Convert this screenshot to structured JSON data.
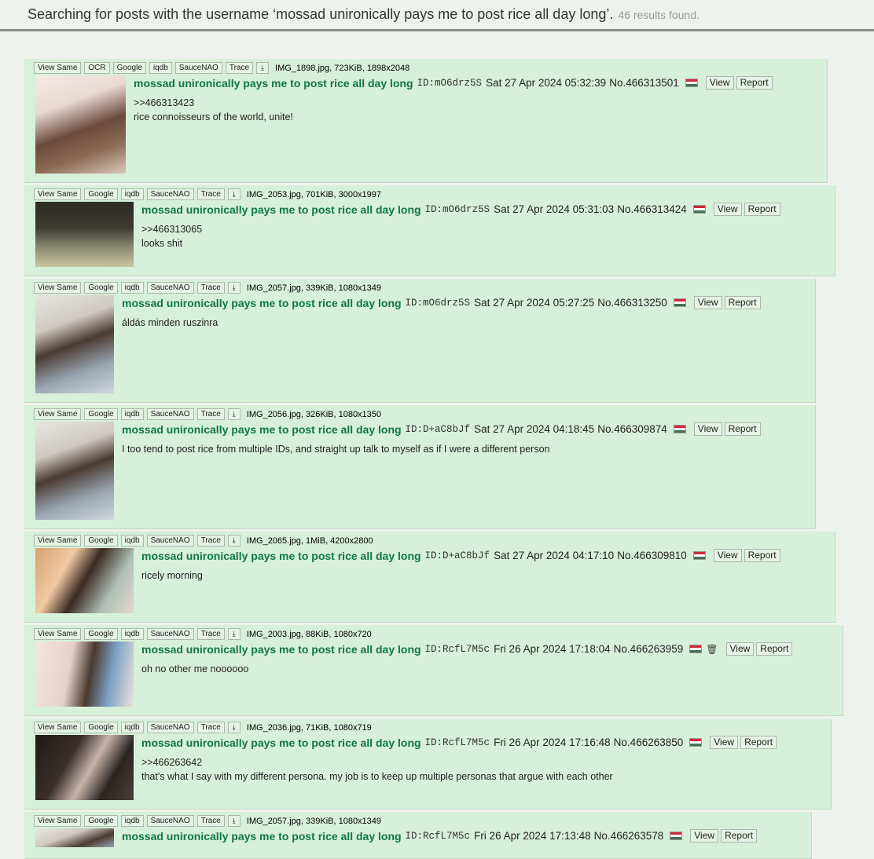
{
  "header": {
    "text": "Searching for posts with the username ‘mossad unironically pays me to post rice all day long’.",
    "count": "46 results found."
  },
  "buttons": {
    "view_same": "View Same",
    "ocr": "OCR",
    "google": "Google",
    "iqdb": "iqdb",
    "saucenao": "SauceNAO",
    "trace": "Trace",
    "view": "View",
    "report": "Report"
  },
  "posts": [
    {
      "file": "IMG_1898.jpg, 723KiB, 1898x2048",
      "name": "mossad unironically pays me to post rice all day long",
      "uid": "ID:mO6drz5S",
      "datetime": "Sat 27 Apr 2024 05:32:39",
      "no": "No.466313501",
      "quote": ">>466313423",
      "text": "rice connoisseurs of the world, unite!"
    },
    {
      "file": "IMG_2053.jpg, 701KiB, 3000x1997",
      "name": "mossad unironically pays me to post rice all day long",
      "uid": "ID:mO6drz5S",
      "datetime": "Sat 27 Apr 2024 05:31:03",
      "no": "No.466313424",
      "quote": ">>466313065",
      "text": "looks shit"
    },
    {
      "file": "IMG_2057.jpg, 339KiB, 1080x1349",
      "name": "mossad unironically pays me to post rice all day long",
      "uid": "ID:mO6drz5S",
      "datetime": "Sat 27 Apr 2024 05:27:25",
      "no": "No.466313250",
      "quote": "",
      "text": "áldás minden ruszinra"
    },
    {
      "file": "IMG_2056.jpg, 326KiB, 1080x1350",
      "name": "mossad unironically pays me to post rice all day long",
      "uid": "ID:D+aC8bJf",
      "datetime": "Sat 27 Apr 2024 04:18:45",
      "no": "No.466309874",
      "quote": "",
      "text": "I too tend to post rice from multiple IDs, and straight up talk to myself as if I were a different person"
    },
    {
      "file": "IMG_2065.jpg, 1MiB, 4200x2800",
      "name": "mossad unironically pays me to post rice all day long",
      "uid": "ID:D+aC8bJf",
      "datetime": "Sat 27 Apr 2024 04:17:10",
      "no": "No.466309810",
      "quote": "",
      "text": "ricely morning"
    },
    {
      "file": "IMG_2003.jpg, 88KiB, 1080x720",
      "name": "mossad unironically pays me to post rice all day long",
      "uid": "ID:RcfL7M5c",
      "datetime": "Fri 26 Apr 2024 17:18:04",
      "no": "No.466263959",
      "quote": "",
      "text": "oh no other me noooooo"
    },
    {
      "file": "IMG_2036.jpg, 71KiB, 1080x719",
      "name": "mossad unironically pays me to post rice all day long",
      "uid": "ID:RcfL7M5c",
      "datetime": "Fri 26 Apr 2024 17:16:48",
      "no": "No.466263850",
      "quote": ">>466263642",
      "text": "that's what I say with my different persona. my job is to keep up multiple personas that argue with each other"
    },
    {
      "file": "IMG_2057.jpg, 339KiB, 1080x1349",
      "name": "mossad unironically pays me to post rice all day long",
      "uid": "ID:RcfL7M5c",
      "datetime": "Fri 26 Apr 2024 17:13:48",
      "no": "No.466263578",
      "quote": "",
      "text": ""
    }
  ]
}
